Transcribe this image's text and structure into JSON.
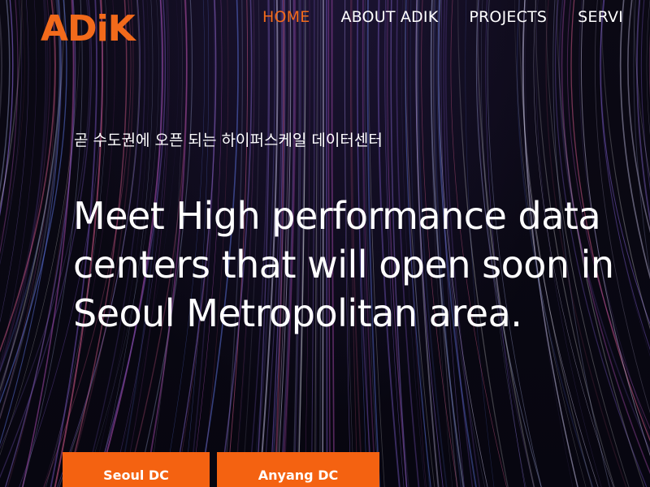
{
  "brand": {
    "logo_text": "ADiK",
    "accent_color": "#f26a1b"
  },
  "nav": {
    "items": [
      {
        "label": "HOME",
        "active": true
      },
      {
        "label": "ABOUT ADIK",
        "active": false
      },
      {
        "label": "PROJECTS",
        "active": false
      },
      {
        "label": "SERVI",
        "active": false
      }
    ]
  },
  "hero": {
    "subtitle": "곧 수도권에 오픈 되는 하이퍼스케일 데이터센터",
    "headline_lines": [
      "Meet High performance data",
      "centers that will open soon in",
      "Seoul Metropolitan area."
    ]
  },
  "cta": {
    "buttons": [
      {
        "label": "Seoul DC",
        "color": "#f46211"
      },
      {
        "label": "Anyang DC",
        "color": "#f46211"
      }
    ]
  }
}
